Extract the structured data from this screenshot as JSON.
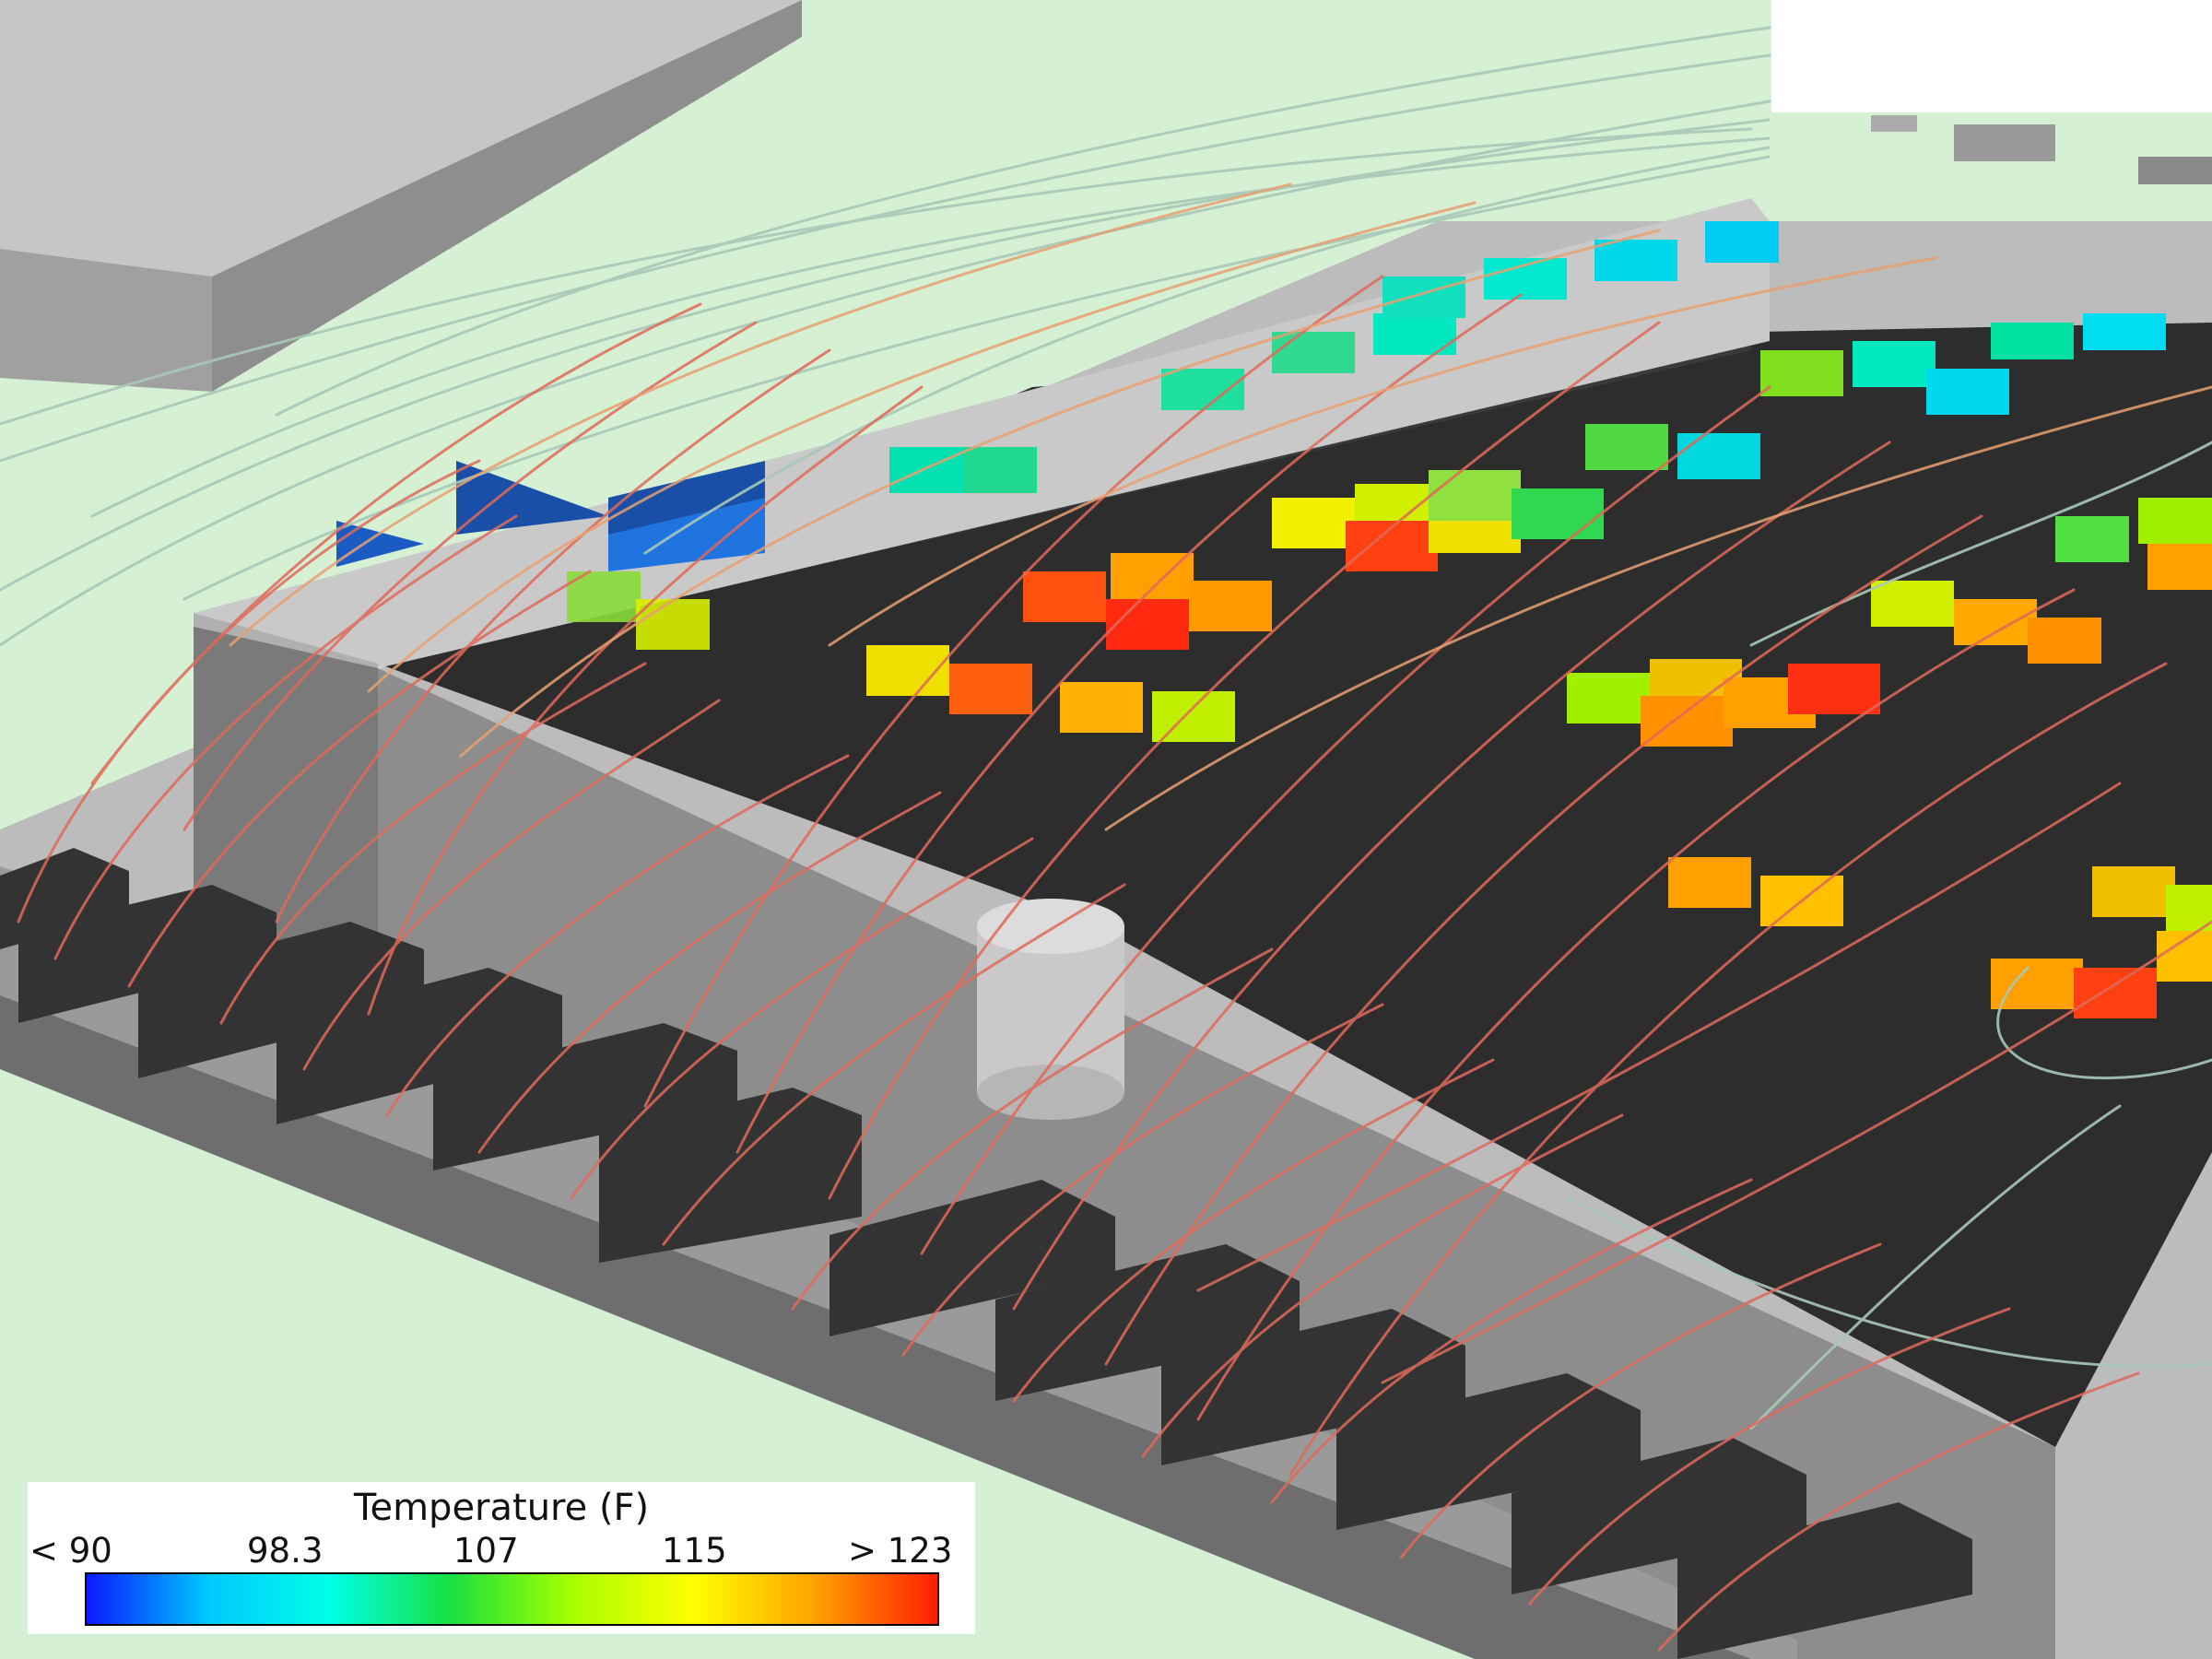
{
  "view": {
    "colors": {
      "background": "#d6f0d4",
      "board": "#2e2e2e",
      "enclosure": "#8c8c8c",
      "enclosure_top": "#bdbdbd",
      "connector": "#3a3a3a",
      "fan_blade": "#1f5fbf"
    }
  },
  "legend": {
    "title": "Temperature (F)",
    "ticks": [
      "< 90",
      "98.3",
      "107",
      "115",
      "> 123"
    ],
    "colormap": [
      "#0a1aff",
      "#00c8ff",
      "#00ffe8",
      "#18e040",
      "#a8ff00",
      "#ffff00",
      "#ffa000",
      "#ff2000"
    ],
    "range": [
      90,
      123
    ]
  },
  "scene_icons": {
    "streamlines": "streamlines-icon",
    "components": "component-icon",
    "fan": "fan-icon"
  }
}
